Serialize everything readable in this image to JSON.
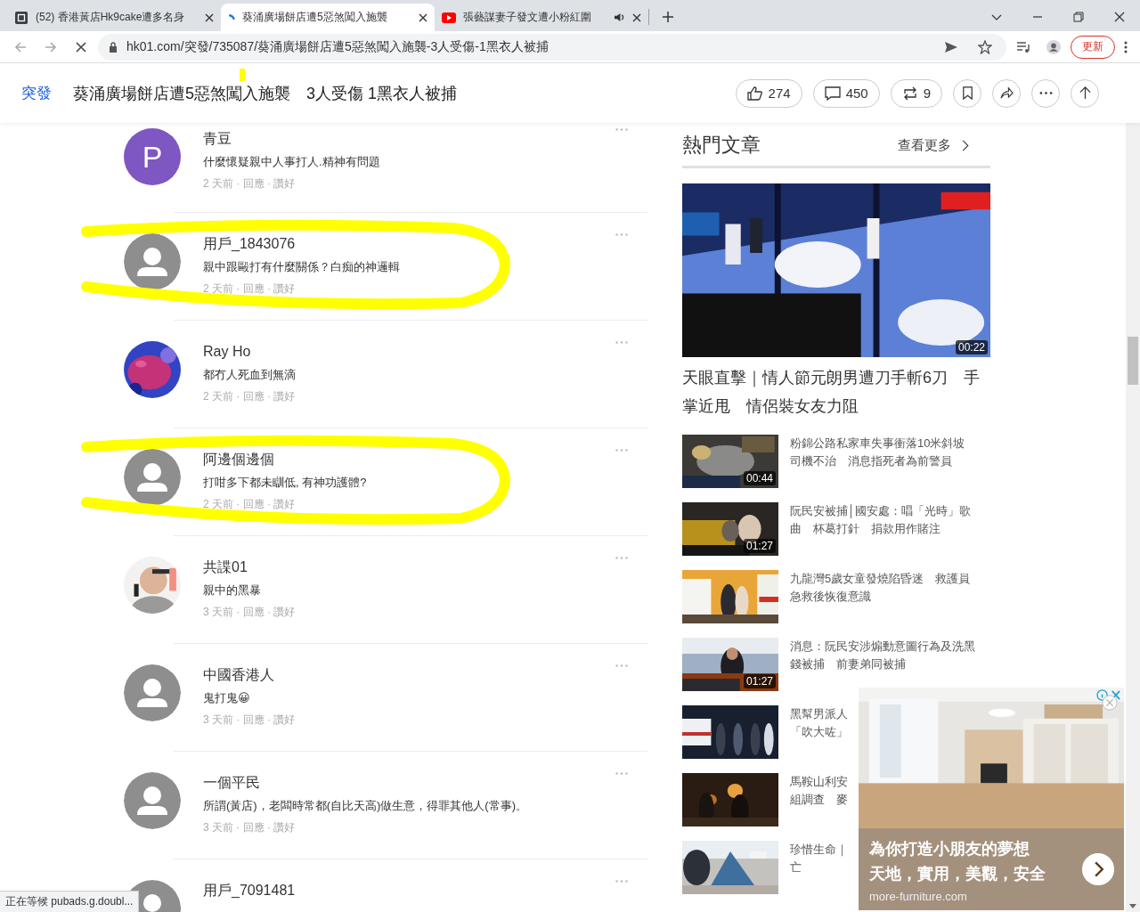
{
  "tabs": [
    {
      "kind": "site",
      "title": "(52) 香港黃店Hk9cake遭多名身",
      "selected": false,
      "audio": false
    },
    {
      "kind": "loading",
      "title": "葵涌廣場餅店遭5惡煞闖入施襲",
      "selected": true,
      "audio": false
    },
    {
      "kind": "video",
      "title": "張藝謀妻子發文遭小粉紅圍",
      "selected": false,
      "audio": true
    }
  ],
  "address_bar": {
    "url": "hk01.com/突發/735087/葵涌廣場餅店遭5惡煞闖入施襲-3人受傷-1黑衣人被捕",
    "update_button": "更新"
  },
  "article_header": {
    "category": "突發",
    "title": "葵涌廣場餅店遭5惡煞闖入施襲　3人受傷 1黑衣人被捕",
    "marked": true,
    "actions": [
      {
        "kind": "like",
        "count": "274"
      },
      {
        "kind": "comment",
        "count": "450"
      },
      {
        "kind": "repost",
        "count": "9"
      },
      {
        "kind": "bookmark"
      },
      {
        "kind": "share"
      },
      {
        "kind": "more"
      },
      {
        "kind": "top"
      }
    ]
  },
  "comments": [
    {
      "kind": "letter",
      "letter": "P",
      "color": "#7e57c2",
      "name": "青豆",
      "text": "什麼懷疑親中人事打人.精神有問題",
      "meta": "2 天前 · 回應 · 讚好",
      "circled": false
    },
    {
      "kind": "default",
      "name": "用戶_1843076",
      "text": "親中跟毆打有什麼關係？白痴的神邏輯",
      "meta": "2 天前 · 回應 · 讚好",
      "circled": true
    },
    {
      "name": "Ray Ho",
      "text": "都冇人死血到無滴",
      "meta": "2 天前 · 回應 · 讚好",
      "circled": false
    },
    {
      "kind": "default",
      "name": "阿邊個邊個",
      "text": "打咁多下都未瞓低, 有神功護體?",
      "meta": "2 天前 · 回應 · 讚好",
      "circled": true
    },
    {
      "name": "共諜01",
      "text": "親中的黑暴",
      "meta": "3 天前 · 回應 · 讚好",
      "circled": false
    },
    {
      "kind": "default",
      "name": "中國香港人",
      "text": "鬼打鬼😀",
      "meta": "3 天前 · 回應 · 讚好",
      "circled": false
    },
    {
      "kind": "default",
      "name": "一個平民",
      "text": "所謂(黃店)，老闆時常都(自比天高)做生意，得罪其他人(常事)。",
      "meta": "3 天前 · 回應 · 讚好",
      "circled": false
    },
    {
      "kind": "default",
      "name": "用戶_7091481",
      "circled": false
    }
  ],
  "popular": {
    "heading": "熱門文章",
    "more_link": "查看更多",
    "featured": {
      "kind": "picture",
      "duration": "00:22",
      "title": "天眼直擊｜情人節元朗男遭刀手斬6刀　手掌近甩　情侶裝女友力阻"
    },
    "items": [
      {
        "kind": "picture",
        "duration": "00:44",
        "lines": [
          "粉錦公路私家車失事衝落10米斜坡",
          "司機不治　消息指死者為前警員"
        ]
      },
      {
        "kind": "picture",
        "duration": "01:27",
        "lines": [
          "阮民安被捕│國安處：唱「光時」歌",
          "曲　杯葛打針　捐款用作賭注"
        ]
      },
      {
        "kind": "picture",
        "lines": [
          "九龍灣5歲女童發燒陷昏迷　救護員",
          "急救後恢復意識"
        ]
      },
      {
        "kind": "picture",
        "duration": "01:27",
        "lines": [
          "消息：阮民安涉煽動意圖行為及洗黑",
          "錢被捕　前妻弟同被捕"
        ]
      },
      {
        "kind": "picture",
        "lines": [
          "黑幫男派人",
          "「吹大咗」"
        ]
      },
      {
        "kind": "picture",
        "lines": [
          "馬鞍山利安",
          "組調查　麥"
        ]
      },
      {
        "kind": "picture",
        "lines": [
          "珍惜生命｜",
          "亡"
        ]
      }
    ]
  },
  "ad": {
    "kind": "picture",
    "headline": [
      "為你打造小朋友的夢想",
      "天地，實用，美觀，安全"
    ],
    "domain": "more-furniture.com"
  },
  "status_bar": "正在等候 pubads.g.doubl..."
}
